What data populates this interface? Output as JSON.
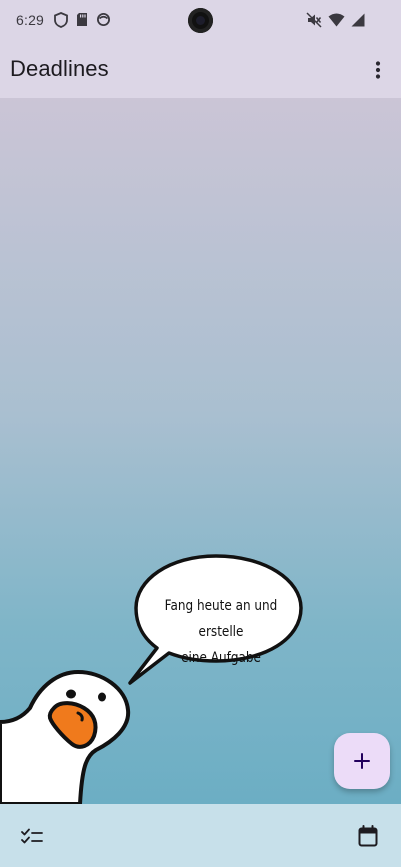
{
  "status_bar": {
    "time": "6:29",
    "left_icons": [
      "shield-icon",
      "sd-card-icon",
      "sync-icon"
    ],
    "right_icons": [
      "vibrate-off-icon",
      "wifi-icon",
      "signal-icon"
    ]
  },
  "app_bar": {
    "title": "Deadlines",
    "menu_icon": "more-vert-icon"
  },
  "empty_state": {
    "bubble_line1": "Fang heute an und erstelle",
    "bubble_line2": "eine Aufgabe",
    "mascot": "goose"
  },
  "fab": {
    "icon": "add-icon",
    "label": "+"
  },
  "bottom_bar": {
    "left_icon": "checklist-icon",
    "right_icon": "calendar-icon"
  },
  "colors": {
    "app_bar": "#dcd6e6",
    "fab": "#ecdcf8",
    "bottom_bar": "#c7e0ea",
    "gradient_top": "#cbc5d6",
    "gradient_bottom": "#6caec4",
    "beak": "#f07a1c"
  }
}
